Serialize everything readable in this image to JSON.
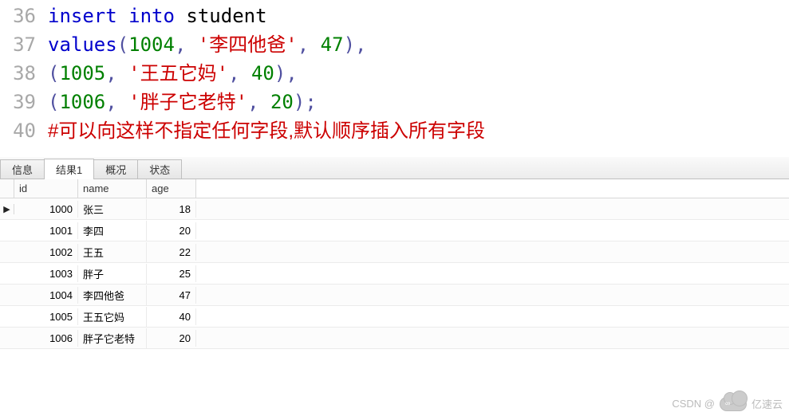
{
  "code": {
    "lines": [
      {
        "num": "36",
        "tokens": [
          {
            "t": "insert",
            "c": "kw"
          },
          {
            "t": " ",
            "c": "space"
          },
          {
            "t": "into",
            "c": "kw"
          },
          {
            "t": " ",
            "c": "space"
          },
          {
            "t": "student",
            "c": "ident"
          }
        ]
      },
      {
        "num": "37",
        "tokens": [
          {
            "t": "values",
            "c": "kw"
          },
          {
            "t": "(",
            "c": "punct"
          },
          {
            "t": "1004",
            "c": "num"
          },
          {
            "t": ",",
            "c": "punct"
          },
          {
            "t": " ",
            "c": "space"
          },
          {
            "t": "'李四他爸'",
            "c": "str"
          },
          {
            "t": ",",
            "c": "punct"
          },
          {
            "t": " ",
            "c": "space"
          },
          {
            "t": "47",
            "c": "num"
          },
          {
            "t": ")",
            "c": "punct"
          },
          {
            "t": ",",
            "c": "punct"
          }
        ]
      },
      {
        "num": "38",
        "tokens": [
          {
            "t": "(",
            "c": "punct"
          },
          {
            "t": "1005",
            "c": "num"
          },
          {
            "t": ",",
            "c": "punct"
          },
          {
            "t": " ",
            "c": "space"
          },
          {
            "t": "'王五它妈'",
            "c": "str"
          },
          {
            "t": ",",
            "c": "punct"
          },
          {
            "t": " ",
            "c": "space"
          },
          {
            "t": "40",
            "c": "num"
          },
          {
            "t": ")",
            "c": "punct"
          },
          {
            "t": ",",
            "c": "punct"
          }
        ]
      },
      {
        "num": "39",
        "tokens": [
          {
            "t": "(",
            "c": "punct"
          },
          {
            "t": "1006",
            "c": "num"
          },
          {
            "t": ",",
            "c": "punct"
          },
          {
            "t": " ",
            "c": "space"
          },
          {
            "t": "'胖子它老特'",
            "c": "str"
          },
          {
            "t": ",",
            "c": "punct"
          },
          {
            "t": " ",
            "c": "space"
          },
          {
            "t": "20",
            "c": "num"
          },
          {
            "t": ")",
            "c": "punct"
          },
          {
            "t": ";",
            "c": "punct"
          }
        ]
      },
      {
        "num": "40",
        "tokens": [
          {
            "t": "#可以向这样不指定任何字段,默认顺序插入所有字段",
            "c": "comment"
          }
        ]
      }
    ]
  },
  "tabs": {
    "items": [
      {
        "label": "信息",
        "active": false
      },
      {
        "label": "结果1",
        "active": true
      },
      {
        "label": "概况",
        "active": false
      },
      {
        "label": "状态",
        "active": false
      }
    ]
  },
  "grid": {
    "columns": [
      {
        "key": "id",
        "label": "id"
      },
      {
        "key": "name",
        "label": "name"
      },
      {
        "key": "age",
        "label": "age"
      }
    ],
    "rows": [
      {
        "id": 1000,
        "name": "张三",
        "age": 18,
        "current": true
      },
      {
        "id": 1001,
        "name": "李四",
        "age": 20,
        "current": false
      },
      {
        "id": 1002,
        "name": "王五",
        "age": 22,
        "current": false
      },
      {
        "id": 1003,
        "name": "胖子",
        "age": 25,
        "current": false
      },
      {
        "id": 1004,
        "name": "李四他爸",
        "age": 47,
        "current": false
      },
      {
        "id": 1005,
        "name": "王五它妈",
        "age": 40,
        "current": false
      },
      {
        "id": 1006,
        "name": "胖子它老特",
        "age": 20,
        "current": false
      }
    ]
  },
  "watermark": {
    "csdn": "CSDN @",
    "brand": "亿速云"
  }
}
